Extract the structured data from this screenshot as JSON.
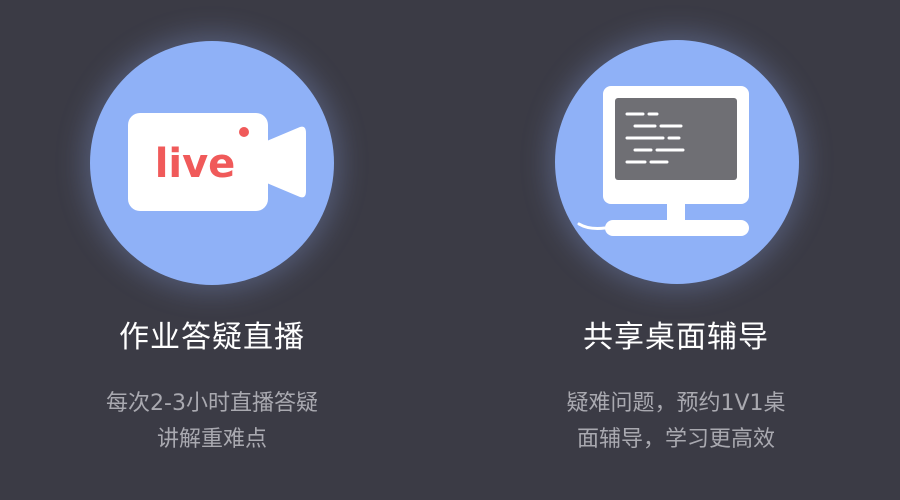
{
  "features": [
    {
      "icon": "live-video-camera-icon",
      "icon_text": "live",
      "title": "作业答疑直播",
      "desc_lines": [
        "每次2-3小时直播答疑",
        "讲解重难点"
      ]
    },
    {
      "icon": "desktop-monitor-icon",
      "title": "共享桌面辅导",
      "desc_lines": [
        "疑难问题，预约1V1桌",
        "面辅导，学习更高效"
      ]
    }
  ],
  "colors": {
    "background": "#3b3b45",
    "circle": "#8fb1f7",
    "accent_red": "#f05a5a",
    "title": "#ffffff",
    "desc": "#a9a9b0"
  }
}
